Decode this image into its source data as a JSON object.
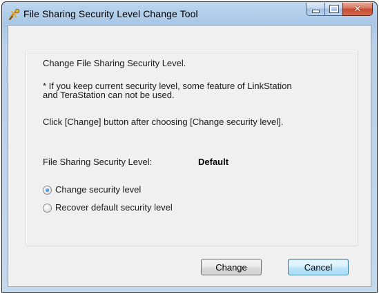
{
  "window": {
    "title": "File Sharing Security Level Change Tool",
    "icon": "buffalo-app-icon"
  },
  "content": {
    "heading": "Change File Sharing Security Level.",
    "warning": "* If you keep current security level, some feature of LinkStation\nand TeraStation can not be used.",
    "instruction": "Click [Change] button after choosing [Change security level].",
    "level_label": "File Sharing Security Level:",
    "level_value": "Default",
    "options": [
      {
        "label": "Change security level",
        "selected": true
      },
      {
        "label": "Recover default security level",
        "selected": false
      }
    ]
  },
  "buttons": {
    "change": "Change",
    "cancel": "Cancel"
  },
  "colors": {
    "title_bar": "#a9c7e6",
    "client_bg": "#f0f0f0",
    "close_button": "#c54a2f",
    "default_button_border": "#3c7fb1"
  }
}
